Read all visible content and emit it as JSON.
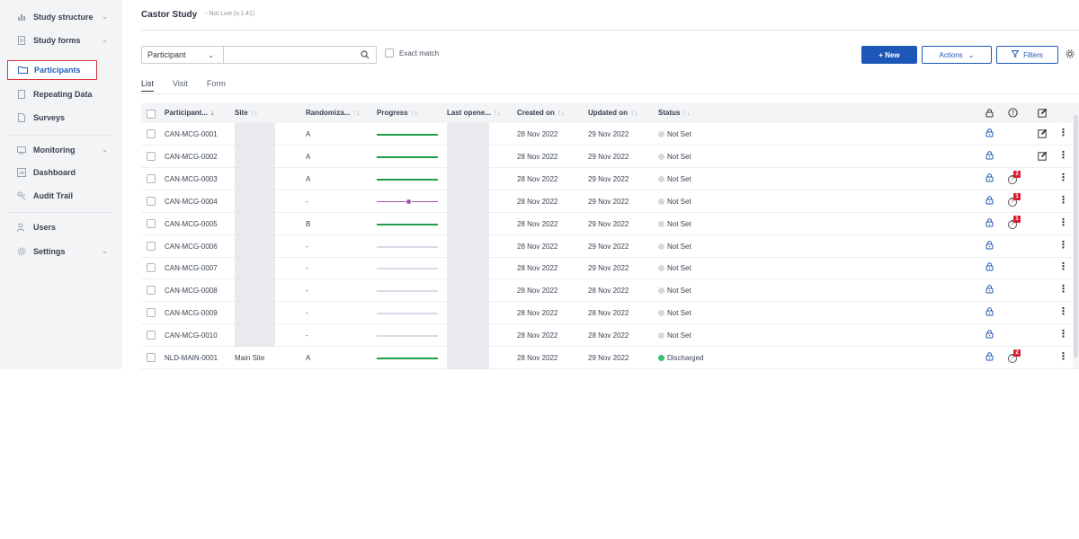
{
  "sidebar": {
    "items": [
      {
        "label": "Study structure",
        "icon": "tree-icon",
        "chevron": true
      },
      {
        "label": "Study forms",
        "icon": "forms-icon",
        "chevron": true
      },
      {
        "label": "Participants",
        "icon": "folder-icon",
        "chevron": false,
        "active": true
      },
      {
        "label": "Repeating Data",
        "icon": "document-icon",
        "chevron": false
      },
      {
        "label": "Surveys",
        "icon": "survey-icon",
        "chevron": false
      },
      {
        "label": "Monitoring",
        "icon": "monitoring-icon",
        "chevron": true
      },
      {
        "label": "Dashboard",
        "icon": "dashboard-icon",
        "chevron": false
      },
      {
        "label": "Audit Trail",
        "icon": "audit-icon",
        "chevron": false
      },
      {
        "label": "Users",
        "icon": "users-icon",
        "chevron": false
      },
      {
        "label": "Settings",
        "icon": "gear-icon",
        "chevron": true
      }
    ]
  },
  "header": {
    "title": "Castor Study",
    "status": "◦ Not Live (v.1.41)"
  },
  "search": {
    "type_label": "Participant",
    "value": "",
    "exact_match_label": "Exact match"
  },
  "toolbar": {
    "new_label": "+  New",
    "actions_label": "Actions",
    "filters_label": "Filters"
  },
  "tabs": [
    {
      "label": "List",
      "active": true
    },
    {
      "label": "Visit",
      "active": false
    },
    {
      "label": "Form",
      "active": false
    }
  ],
  "table": {
    "headers": {
      "participant": "Participant...",
      "site": "Site",
      "randomization": "Randomiza...",
      "progress": "Progress",
      "last_opened": "Last opene...",
      "created_on": "Created on",
      "updated_on": "Updated on",
      "status": "Status"
    },
    "sort_glyph": "↑↓",
    "sort_active_glyph": "↓",
    "rows": [
      {
        "id": "CAN-MCG-0001",
        "site": "",
        "rand": "A",
        "progress": 1,
        "created": "28 Nov 2022",
        "updated": "29 Nov 2022",
        "status": "Not Set",
        "queries": "",
        "edit": true
      },
      {
        "id": "CAN-MCG-0002",
        "site": "",
        "rand": "A",
        "progress": 1,
        "created": "28 Nov 2022",
        "updated": "29 Nov 2022",
        "status": "Not Set",
        "queries": "",
        "edit": true
      },
      {
        "id": "CAN-MCG-0003",
        "site": "",
        "rand": "A",
        "progress": 1,
        "created": "28 Nov 2022",
        "updated": "29 Nov 2022",
        "status": "Not Set",
        "queries": "2",
        "edit": false
      },
      {
        "id": "CAN-MCG-0004",
        "site": "",
        "rand": "-",
        "progress": 0.5,
        "created": "28 Nov 2022",
        "updated": "29 Nov 2022",
        "status": "Not Set",
        "queries": "1",
        "edit": false
      },
      {
        "id": "CAN-MCG-0005",
        "site": "",
        "rand": "B",
        "progress": 1,
        "created": "28 Nov 2022",
        "updated": "29 Nov 2022",
        "status": "Not Set",
        "queries": "1",
        "edit": false
      },
      {
        "id": "CAN-MCG-0006",
        "site": "",
        "rand": "-",
        "progress": 0,
        "created": "28 Nov 2022",
        "updated": "29 Nov 2022",
        "status": "Not Set",
        "queries": "",
        "edit": false
      },
      {
        "id": "CAN-MCG-0007",
        "site": "",
        "rand": "-",
        "progress": 0,
        "created": "28 Nov 2022",
        "updated": "29 Nov 2022",
        "status": "Not Set",
        "queries": "",
        "edit": false
      },
      {
        "id": "CAN-MCG-0008",
        "site": "",
        "rand": "-",
        "progress": 0,
        "created": "28 Nov 2022",
        "updated": "28 Nov 2022",
        "status": "Not Set",
        "queries": "",
        "edit": false
      },
      {
        "id": "CAN-MCG-0009",
        "site": "",
        "rand": "-",
        "progress": 0,
        "created": "28 Nov 2022",
        "updated": "28 Nov 2022",
        "status": "Not Set",
        "queries": "",
        "edit": false
      },
      {
        "id": "CAN-MCG-0010",
        "site": "",
        "rand": "-",
        "progress": 0,
        "created": "28 Nov 2022",
        "updated": "28 Nov 2022",
        "status": "Not Set",
        "queries": "",
        "edit": false
      },
      {
        "id": "NLD-MAIN-0001",
        "site": "Main Site",
        "rand": "A",
        "progress": 1,
        "created": "28 Nov 2022",
        "updated": "29 Nov 2022",
        "status": "Discharged",
        "queries": "2",
        "edit": false
      }
    ]
  },
  "colors": {
    "accent": "#1d58b8",
    "progress_complete": "#1e9e4e",
    "progress_partial": "#a050a8",
    "status_discharged": "#3cbf6a",
    "query_badge": "#d71d2f"
  }
}
